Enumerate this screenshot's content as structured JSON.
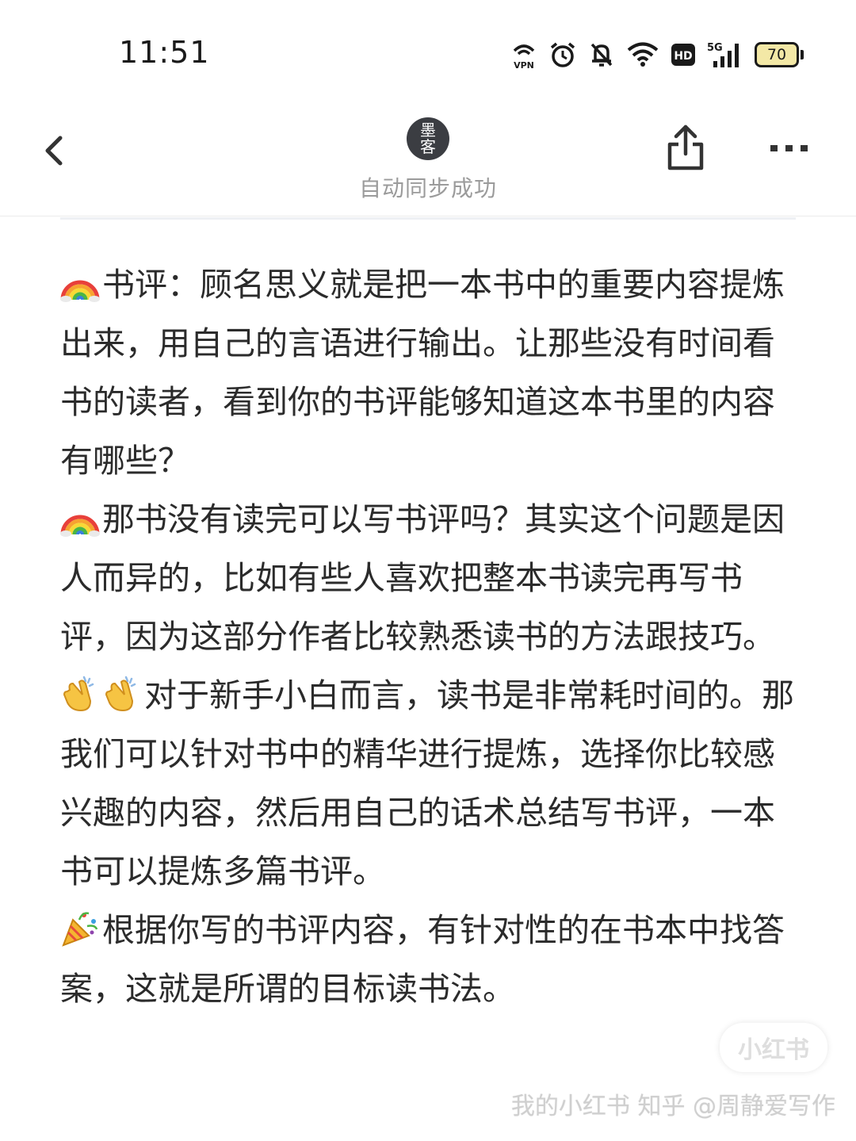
{
  "status_bar": {
    "time": "11:51",
    "icons": [
      "vpn-icon",
      "alarm-icon",
      "mute-bell-icon",
      "wifi-icon",
      "hd-icon",
      "5g-signal-icon"
    ],
    "vpn_label": "VPN",
    "hd_label": "HD",
    "network_label": "5G",
    "battery_level": "70"
  },
  "header": {
    "avatar_text_top": "墨",
    "avatar_text_bottom": "客",
    "sync_status": "自动同步成功",
    "back_icon": "chevron-left-icon",
    "share_icon": "share-icon",
    "more_icon": "more-dots-icon"
  },
  "article": {
    "paragraphs": [
      {
        "emoji": "rainbow",
        "text": "书评：顾名思义就是把一本书中的重要内容提炼出来，用自己的言语进行输出。让那些没有时间看书的读者，看到你的书评能够知道这本书里的内容有哪些？"
      },
      {
        "emoji": "rainbow",
        "text": "那书没有读完可以写书评吗？其实这个问题是因人而异的，比如有些人喜欢把整本书读完再写书评，因为这部分作者比较熟悉读书的方法跟技巧。"
      },
      {
        "emoji": "clapping-hands-x2",
        "text": "对于新手小白而言，读书是非常耗时间的。那我们可以针对书中的精华进行提炼，选择你比较感兴趣的内容，然后用自己的话术总结写书评，一本书可以提炼多篇书评。"
      },
      {
        "emoji": "party-popper",
        "text": "根据你写的书评内容，有针对性的在书本中找答案，这就是所谓的目标读书法。"
      }
    ]
  },
  "watermarks": {
    "badge": "小红书",
    "credit": "我的小红书 知乎 @周静爱写作"
  },
  "colors": {
    "text": "#2b2b2b",
    "muted": "#9b9b9b",
    "avatar_bg": "#3b3d42",
    "battery_fill": "#f3e8a6"
  }
}
